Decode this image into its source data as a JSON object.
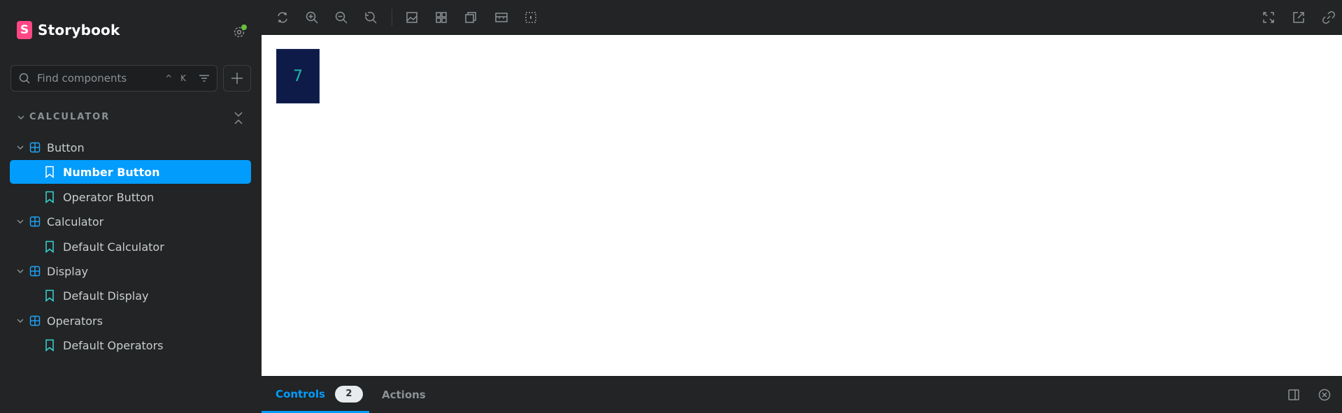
{
  "brand": {
    "logo_letter": "S",
    "name": "Storybook"
  },
  "search": {
    "placeholder": "Find components",
    "shortcut": "^ K"
  },
  "tree": {
    "section_label": "CALCULATOR",
    "items": [
      {
        "type": "component",
        "label": "Button"
      },
      {
        "type": "story",
        "label": "Number Button",
        "selected": true
      },
      {
        "type": "story",
        "label": "Operator Button"
      },
      {
        "type": "component",
        "label": "Calculator"
      },
      {
        "type": "story",
        "label": "Default Calculator"
      },
      {
        "type": "component",
        "label": "Display"
      },
      {
        "type": "story",
        "label": "Default Display"
      },
      {
        "type": "component",
        "label": "Operators"
      },
      {
        "type": "story",
        "label": "Default Operators"
      }
    ]
  },
  "preview": {
    "button_value": "7"
  },
  "panel": {
    "tabs": [
      {
        "label": "Controls",
        "count": "2",
        "active": true
      },
      {
        "label": "Actions"
      }
    ]
  },
  "colors": {
    "accent": "#029cfd",
    "brand_pink": "#ff4785",
    "status_dot": "#66bf3c",
    "component_icon": "#1ea7fd",
    "story_icon": "#37d5d3",
    "number_button_bg": "#0e1a47",
    "number_button_text": "#21b7a8"
  },
  "icons": {
    "toolbar": [
      "remount-icon",
      "zoom-in-icon",
      "zoom-out-icon",
      "zoom-reset-icon",
      "background-icon",
      "grid-icon",
      "viewport-icon",
      "measure-icon",
      "outline-icon"
    ],
    "toolbar_right": [
      "fullscreen-icon",
      "open-new-tab-icon",
      "copy-link-icon"
    ],
    "panel_right": [
      "panel-position-icon",
      "close-panel-icon"
    ]
  }
}
